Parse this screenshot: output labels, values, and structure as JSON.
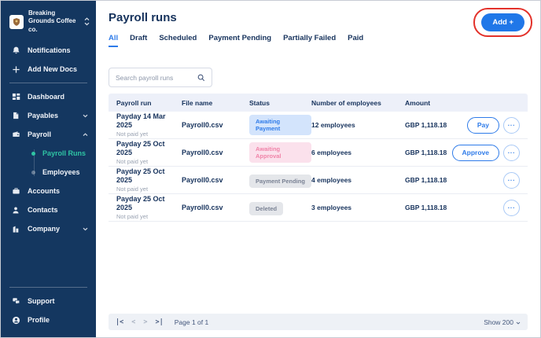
{
  "colors": {
    "sidebar_bg": "#143760",
    "accent_blue": "#2e7be9",
    "add_button_bg": "#2077e8",
    "active_item_teal": "#2fc5a4",
    "navy_text": "#16325c",
    "muted_text": "#9aa3b2",
    "annotation_red": "#e3312a",
    "badge_blue_bg": "#d3e4fc",
    "badge_blue_text": "#2e7be9",
    "badge_pink_bg": "#fbe1ec",
    "badge_pink_text": "#f083a8",
    "badge_gray_bg": "#e4e6ea",
    "badge_gray_text": "#7a8294",
    "table_header_bg": "#edf0f9",
    "footer_bg": "#eef1f6"
  },
  "sidebar": {
    "org_name": "Breaking Grounds Coffee co.",
    "primary": [
      {
        "label": "Notifications",
        "icon": "bell"
      },
      {
        "label": "Add New Docs",
        "icon": "plus"
      }
    ],
    "nav": [
      {
        "label": "Dashboard",
        "icon": "dashboard-grid"
      },
      {
        "label": "Payables",
        "icon": "document",
        "chevron": "down"
      },
      {
        "label": "Payroll",
        "icon": "wallet",
        "chevron": "up",
        "expanded": true
      }
    ],
    "payroll_children": [
      {
        "label": "Payroll Runs",
        "active": true
      },
      {
        "label": "Employees",
        "active": false
      }
    ],
    "nav2": [
      {
        "label": "Accounts",
        "icon": "briefcase"
      },
      {
        "label": "Contacts",
        "icon": "person"
      },
      {
        "label": "Company",
        "icon": "building",
        "chevron": "down"
      }
    ],
    "bottom": [
      {
        "label": "Support",
        "icon": "chat"
      },
      {
        "label": "Profile",
        "icon": "profile-circle"
      }
    ]
  },
  "header": {
    "title": "Payroll runs",
    "add_button_label": "Add +"
  },
  "tabs": [
    {
      "label": "All",
      "active": true
    },
    {
      "label": "Draft",
      "active": false
    },
    {
      "label": "Scheduled",
      "active": false
    },
    {
      "label": "Payment Pending",
      "active": false
    },
    {
      "label": "Partially Failed",
      "active": false
    },
    {
      "label": "Paid",
      "active": false
    }
  ],
  "search": {
    "placeholder": "Search payroll runs"
  },
  "table": {
    "columns": [
      "Payroll run",
      "File name",
      "Status",
      "Number of employees",
      "Amount"
    ],
    "rows": [
      {
        "payday": "Payday 14 Mar 2025",
        "note": "Not paid yet",
        "file_name": "Payroll0.csv",
        "status": "Awaiting Payment",
        "status_style": "blue",
        "employees": "12 employees",
        "amount": "GBP 1,118.18",
        "action": "Pay"
      },
      {
        "payday": "Payday 25 Oct 2025",
        "note": "Not paid yet",
        "file_name": "Payroll0.csv",
        "status": "Awaiting Approval",
        "status_style": "pink",
        "employees": "6 employees",
        "amount": "GBP 1,118.18",
        "action": "Approve"
      },
      {
        "payday": "Payday 25 Oct 2025",
        "note": "Not paid yet",
        "file_name": "Payroll0.csv",
        "status": "Payment Pending",
        "status_style": "gray",
        "employees": "4 employees",
        "amount": "GBP 1,118.18",
        "action": ""
      },
      {
        "payday": "Payday 25 Oct 2025",
        "note": "Not paid yet",
        "file_name": "Payroll0.csv",
        "status": "Deleted",
        "status_style": "gray",
        "employees": "3 employees",
        "amount": "GBP 1,118.18",
        "action": ""
      }
    ]
  },
  "icons": {
    "ellipsis": "···",
    "first_page": "|<",
    "prev_page": "<",
    "next_page": ">",
    "last_page": ">|"
  },
  "pagination": {
    "page_label": "Page 1 of 1",
    "show_label": "Show 200"
  }
}
